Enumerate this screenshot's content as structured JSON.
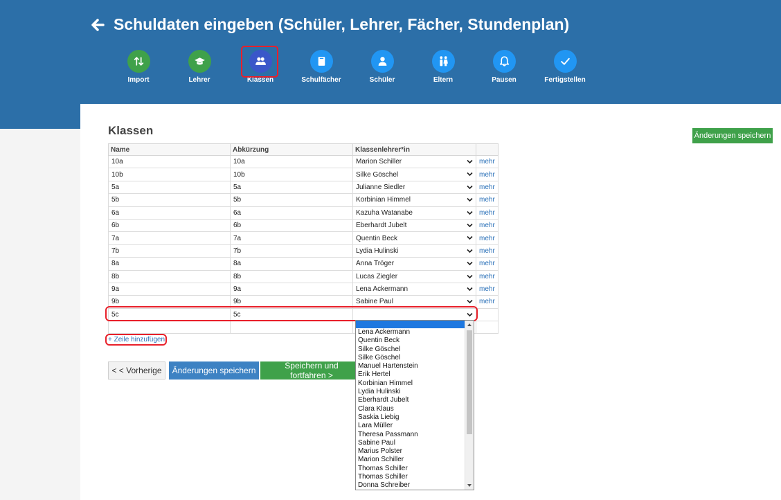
{
  "header": {
    "title": "Schuldaten eingeben (Schüler, Lehrer, Fächer, Stundenplan)"
  },
  "steps": [
    {
      "label": "Import",
      "icon": "import-arrows-icon",
      "color": "#3fa14a"
    },
    {
      "label": "Lehrer",
      "icon": "graduation-cap-icon",
      "color": "#3fa14a"
    },
    {
      "label": "Klassen",
      "icon": "group-icon",
      "color": "#3a57c9",
      "active": true
    },
    {
      "label": "Schulfächer",
      "icon": "book-icon",
      "color": "#2196f3"
    },
    {
      "label": "Schüler",
      "icon": "person-icon",
      "color": "#2196f3"
    },
    {
      "label": "Eltern",
      "icon": "parents-icon",
      "color": "#2196f3"
    },
    {
      "label": "Pausen",
      "icon": "bell-icon",
      "color": "#2196f3"
    },
    {
      "label": "Fertigstellen",
      "icon": "checkmark-icon",
      "color": "#2196f3"
    }
  ],
  "section": {
    "title": "Klassen",
    "save_top": "Änderungen speichern"
  },
  "table": {
    "headers": [
      "Name",
      "Abkürzung",
      "Klassenlehrer*in",
      ""
    ],
    "more_label": "mehr",
    "rows": [
      {
        "name": "10a",
        "abbr": "10a",
        "teacher": "Marion Schiller"
      },
      {
        "name": "10b",
        "abbr": "10b",
        "teacher": "Silke Göschel"
      },
      {
        "name": "5a",
        "abbr": "5a",
        "teacher": "Julianne Siedler"
      },
      {
        "name": "5b",
        "abbr": "5b",
        "teacher": "Korbinian Himmel"
      },
      {
        "name": "6a",
        "abbr": "6a",
        "teacher": "Kazuha Watanabe"
      },
      {
        "name": "6b",
        "abbr": "6b",
        "teacher": "Eberhardt Jubelt"
      },
      {
        "name": "7a",
        "abbr": "7a",
        "teacher": "Quentin Beck"
      },
      {
        "name": "7b",
        "abbr": "7b",
        "teacher": "Lydia Hulinski"
      },
      {
        "name": "8a",
        "abbr": "8a",
        "teacher": "Anna Tröger"
      },
      {
        "name": "8b",
        "abbr": "8b",
        "teacher": "Lucas Ziegler"
      },
      {
        "name": "9a",
        "abbr": "9a",
        "teacher": "Lena Ackermann"
      },
      {
        "name": "9b",
        "abbr": "9b",
        "teacher": "Sabine Paul"
      }
    ],
    "new_row": {
      "name": "5c",
      "abbr": "5c",
      "teacher": ""
    }
  },
  "add_row_label": "+ Zeile hinzufügen",
  "buttons": {
    "prev": "< < Vorherige",
    "save": "Änderungen speichern",
    "next": "Speichern und fortfahren >"
  },
  "dropdown": {
    "options": [
      "Lena Ackermann",
      "Quentin Beck",
      "Silke Göschel",
      "Silke Göschel",
      "Manuel Hartenstein",
      "Erik Hertel",
      "Korbinian Himmel",
      "Lydia Hulinski",
      "Eberhardt Jubelt",
      "Clara Klaus",
      "Saskia Liebig",
      "Lara Müller",
      "Theresa Passmann",
      "Sabine Paul",
      "Marius Polster",
      "Marion Schiller",
      "Thomas Schiller",
      "Thomas Schiller",
      "Donna Schreiber"
    ]
  },
  "colors": {
    "header_bg": "#2c6fa8",
    "done_step": "#3fa14a",
    "todo_step": "#2196f3",
    "active_step": "#3a57c9",
    "highlight": "#e8202a",
    "link": "#2a70b8"
  }
}
